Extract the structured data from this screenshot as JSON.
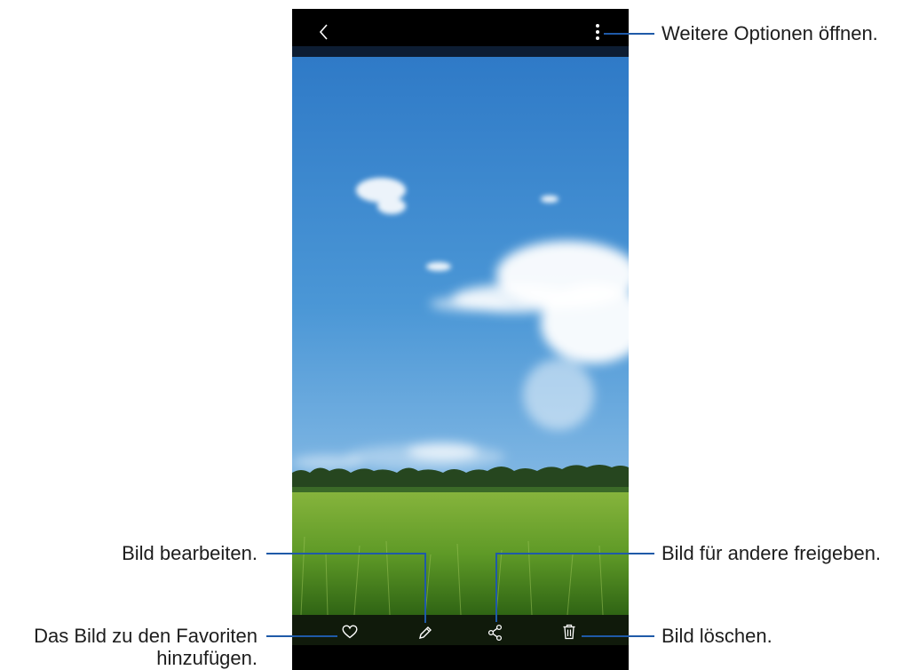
{
  "viewer": {
    "top_bar": {
      "back_icon": "chevron-left-icon",
      "more_icon": "more-vertical-icon"
    },
    "photo": {
      "description_icon": "landscape-photo"
    },
    "bottom_bar": {
      "favorite_icon": "heart-icon",
      "edit_icon": "pencil-icon",
      "share_icon": "share-icon",
      "delete_icon": "trash-icon"
    }
  },
  "callouts": {
    "more_options": "Weitere Optionen öffnen.",
    "edit": "Bild bearbeiten.",
    "share": "Bild für andere freigeben.",
    "favorite_line1": "Das Bild zu den Favoriten",
    "favorite_line2": "hinzufügen.",
    "delete": "Bild löschen."
  },
  "colors": {
    "callout_line": "#1f5aa8",
    "bar": "#000000"
  }
}
